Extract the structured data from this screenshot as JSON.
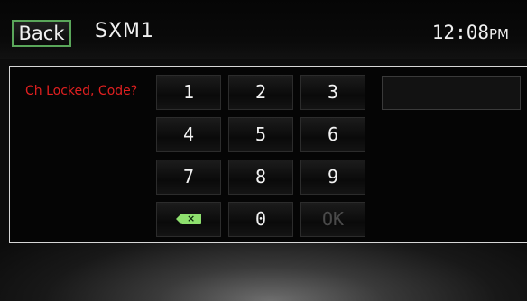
{
  "header": {
    "back_label": "Back",
    "source": "SXM1",
    "time": "12:08",
    "ampm": "PM"
  },
  "prompt": "Ch Locked, Code?",
  "keypad": {
    "k1": "1",
    "k2": "2",
    "k3": "3",
    "k4": "4",
    "k5": "5",
    "k6": "6",
    "k7": "7",
    "k8": "8",
    "k9": "9",
    "k0": "0",
    "ok": "OK",
    "delete_icon": "backspace-icon",
    "delete_color": "#8ee06e"
  },
  "code_input": {
    "value": ""
  },
  "colors": {
    "accent_border": "#5aa65a",
    "prompt_text": "#e02020"
  }
}
